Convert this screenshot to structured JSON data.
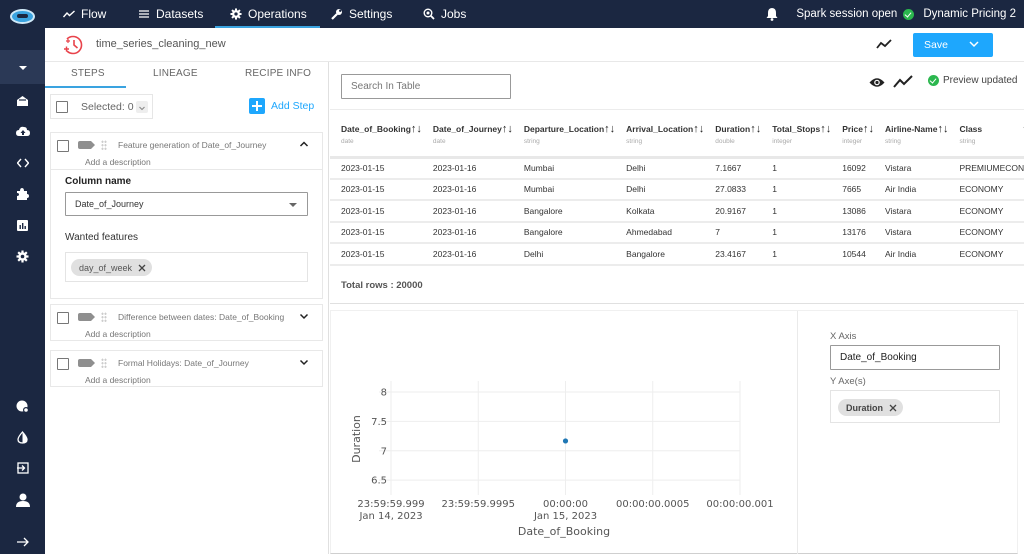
{
  "topnav": {
    "items": [
      {
        "label": "Flow",
        "icon": "trend-line-icon"
      },
      {
        "label": "Datasets",
        "icon": "list-icon"
      },
      {
        "label": "Operations",
        "icon": "gear-icon",
        "active": true
      },
      {
        "label": "Settings",
        "icon": "wrench-icon"
      },
      {
        "label": "Jobs",
        "icon": "search-gear-icon"
      }
    ],
    "session_status": "Spark session open",
    "project_name": "Dynamic Pricing 2"
  },
  "header": {
    "recipe_title": "time_series_cleaning_new",
    "save_label": "Save"
  },
  "left_panel": {
    "tabs": [
      {
        "label": "STEPS",
        "active": true
      },
      {
        "label": "LINEAGE"
      },
      {
        "label": "RECIPE INFO"
      }
    ],
    "selected_label": "Selected: 0",
    "add_step_label": "Add Step",
    "steps": [
      {
        "title": "Feature generation of Date_of_Journey",
        "description_placeholder": "Add a description",
        "expanded": true,
        "column_name_label": "Column name",
        "column_name_value": "Date_of_Journey",
        "wanted_features_label": "Wanted features",
        "wanted_features": [
          "day_of_week"
        ]
      },
      {
        "title": "Difference between dates: Date_of_Booking",
        "description_placeholder": "Add a description",
        "expanded": false
      },
      {
        "title": "Formal Holidays: Date_of_Journey",
        "description_placeholder": "Add a description",
        "expanded": false
      }
    ]
  },
  "main": {
    "search_placeholder": "Search In Table",
    "preview_status": "Preview updated",
    "sort_glyph": "↑↓",
    "columns": [
      {
        "name": "Date_of_Booking",
        "type": "date"
      },
      {
        "name": "Date_of_Journey",
        "type": "date"
      },
      {
        "name": "Departure_Location",
        "type": "string"
      },
      {
        "name": "Arrival_Location",
        "type": "string"
      },
      {
        "name": "Duration",
        "type": "double"
      },
      {
        "name": "Total_Stops",
        "type": "integer"
      },
      {
        "name": "Price",
        "type": "integer"
      },
      {
        "name": "Airline-Name",
        "type": "string"
      },
      {
        "name": "Class",
        "type": "string"
      }
    ],
    "rows": [
      [
        "2023-01-15",
        "2023-01-16",
        "Mumbai",
        "Delhi",
        "7.1667",
        "1",
        "16092",
        "Vistara",
        "PREMIUMECONOMY"
      ],
      [
        "2023-01-15",
        "2023-01-16",
        "Mumbai",
        "Delhi",
        "27.0833",
        "1",
        "7665",
        "Air India",
        "ECONOMY"
      ],
      [
        "2023-01-15",
        "2023-01-16",
        "Bangalore",
        "Kolkata",
        "20.9167",
        "1",
        "13086",
        "Vistara",
        "ECONOMY"
      ],
      [
        "2023-01-15",
        "2023-01-16",
        "Bangalore",
        "Ahmedabad",
        "7",
        "1",
        "13176",
        "Vistara",
        "ECONOMY"
      ],
      [
        "2023-01-15",
        "2023-01-16",
        "Delhi",
        "Bangalore",
        "23.4167",
        "1",
        "10544",
        "Air India",
        "ECONOMY"
      ]
    ],
    "total_rows": "Total rows : 20000",
    "axis_panel": {
      "x_axis_label": "X Axis",
      "x_axis_value": "Date_of_Booking",
      "y_axes_label": "Y Axe(s)",
      "y_axes": [
        "Duration"
      ]
    }
  },
  "colors": {
    "nav_bg": "#1b2741",
    "accent": "#1ea7fd",
    "success": "#2bb74e",
    "recipe_icon": "#e8434b",
    "point": "#1f77b4"
  },
  "chart_data": {
    "type": "scatter",
    "title": "",
    "xlabel": "Date_of_Booking",
    "ylabel": "Duration",
    "x_ticks": [
      {
        "value": -0.001,
        "label": [
          "23:59:59.999",
          "Jan 14, 2023"
        ]
      },
      {
        "value": -0.0005,
        "label": [
          "23:59:59.9995",
          ""
        ]
      },
      {
        "value": 0,
        "label": [
          "00:00:00",
          "Jan 15, 2023"
        ]
      },
      {
        "value": 0.0005,
        "label": [
          "00:00:00.0005",
          ""
        ]
      },
      {
        "value": 0.001,
        "label": [
          "00:00:00.001",
          ""
        ]
      }
    ],
    "x_unit": "seconds offset from 2023-01-15 00:00:00",
    "xlim": [
      -0.001,
      0.001
    ],
    "y_ticks": [
      6.5,
      7,
      7.5,
      8
    ],
    "ylim": [
      6.35,
      8.05
    ],
    "grid": true,
    "series": [
      {
        "name": "Duration",
        "x": [
          0
        ],
        "y": [
          7.1667
        ]
      }
    ]
  }
}
